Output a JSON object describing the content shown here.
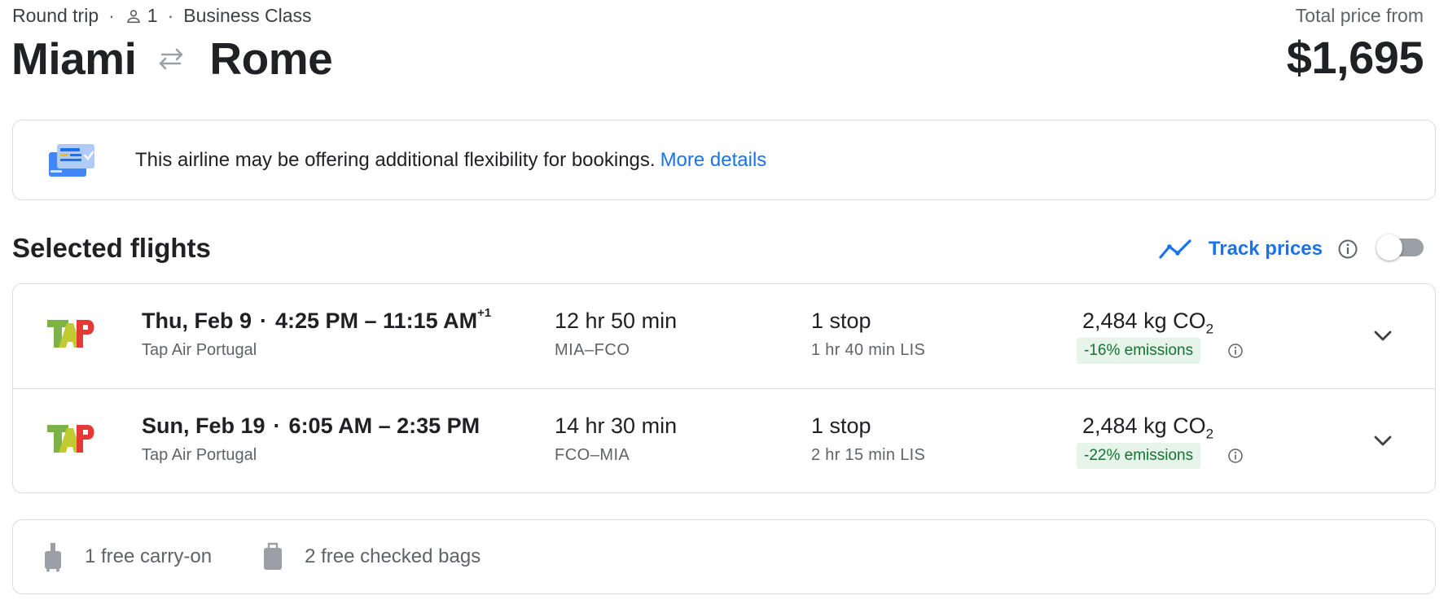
{
  "trip": {
    "type": "Round trip",
    "passengers": "1",
    "cabin": "Business Class",
    "origin": "Miami",
    "destination": "Rome"
  },
  "price": {
    "label": "Total price from",
    "amount": "$1,695"
  },
  "notice": {
    "text": "This airline may be offering additional flexibility for bookings.",
    "link": "More details"
  },
  "section": {
    "title": "Selected flights",
    "track_label": "Track prices",
    "track_enabled": false
  },
  "flights": [
    {
      "date": "Thu, Feb 9",
      "times": "4:25 PM – 11:15 AM",
      "day_offset": "+1",
      "airline": "Tap Air Portugal",
      "duration": "12 hr 50 min",
      "airports": "MIA–FCO",
      "stops": "1 stop",
      "layover": "1 hr 40 min LIS",
      "co2": "2,484 kg CO",
      "co2_sub": "2",
      "emissions": "-16% emissions"
    },
    {
      "date": "Sun, Feb 19",
      "times": "6:05 AM – 2:35 PM",
      "day_offset": "",
      "airline": "Tap Air Portugal",
      "duration": "14 hr 30 min",
      "airports": "FCO–MIA",
      "stops": "1 stop",
      "layover": "2 hr 15 min LIS",
      "co2": "2,484 kg CO",
      "co2_sub": "2",
      "emissions": "-22% emissions"
    }
  ],
  "bags": {
    "carry_on": "1 free carry-on",
    "checked": "2 free checked bags"
  },
  "colors": {
    "link": "#1a73e8",
    "emissions_bg": "#e6f4ea",
    "emissions_text": "#137333",
    "border": "#dadce0"
  }
}
